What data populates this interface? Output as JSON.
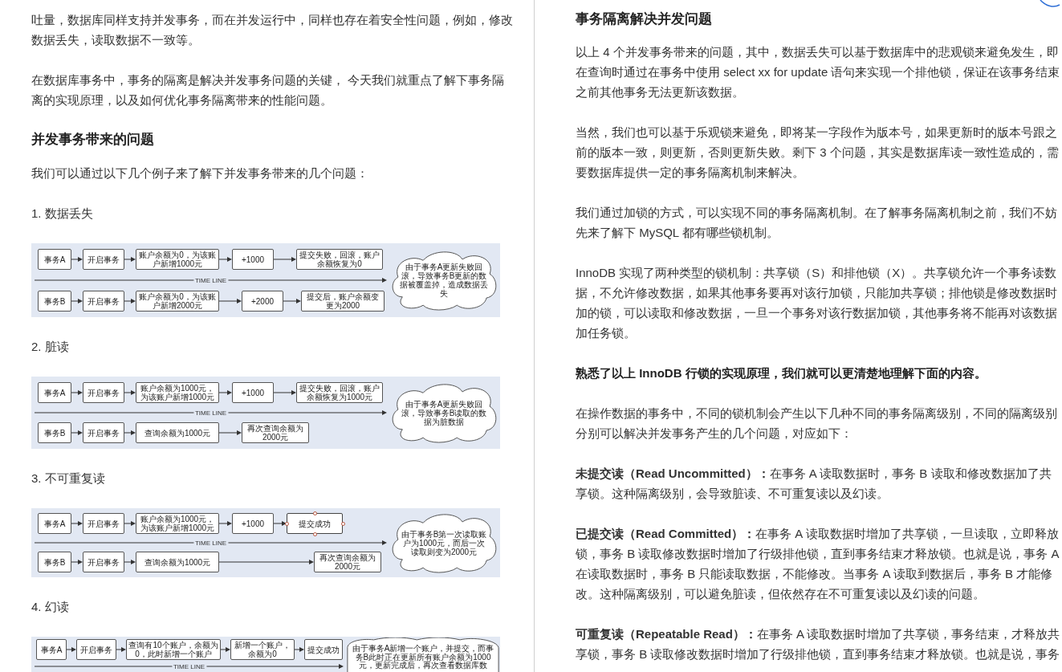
{
  "left_page": {
    "blocks": [
      {
        "kind": "paragraph",
        "text": "吐量，数据库同样支持并发事务，而在并发运行中，同样也存在着安全性问题，例如，修改数据丢失，读取数据不一致等。"
      },
      {
        "kind": "paragraph",
        "text": "在数据库事务中，事务的隔离是解决并发事务问题的关键， 今天我们就重点了解下事务隔离的实现原理，以及如何优化事务隔离带来的性能问题。"
      },
      {
        "kind": "heading",
        "text": "并发事务带来的问题"
      },
      {
        "kind": "paragraph",
        "text": "我们可以通过以下几个例子来了解下并发事务带来的几个问题："
      },
      {
        "kind": "item_title",
        "text": "1. 数据丢失"
      },
      {
        "kind": "diagram",
        "row_a": [
          {
            "text": "事务A",
            "selected": false
          },
          {
            "text": "开启事务",
            "selected": false
          },
          {
            "text": "账户余额为0，为该账户新增1000元",
            "selected": false
          },
          {
            "text": "+1000",
            "selected": false
          },
          {
            "text": "提交失败，回滚，账户余额恢复为0",
            "selected": false
          }
        ],
        "row_b": [
          {
            "text": "事务B",
            "selected": false
          },
          {
            "text": "开启事务",
            "selected": false
          },
          {
            "text": "账户余额为0，为该账户新增2000元",
            "selected": false
          },
          {
            "text": "+2000",
            "selected": false
          },
          {
            "text": "提交后，账户余额变更为2000",
            "selected": false
          }
        ],
        "timeline": "TIME LINE",
        "note": "由于事务A更新失败回滚，导致事务B更新的数据被覆盖掉，造成数据丢失"
      },
      {
        "kind": "item_title",
        "text": "2. 脏读"
      },
      {
        "kind": "diagram",
        "row_a": [
          {
            "text": "事务A",
            "selected": false
          },
          {
            "text": "开启事务",
            "selected": false
          },
          {
            "text": "账户余额为1000元，为该账户新增1000元",
            "selected": false
          },
          {
            "text": "+1000",
            "selected": false
          },
          {
            "text": "提交失败，回滚，账户余额恢复为1000元",
            "selected": false
          }
        ],
        "row_b": [
          {
            "text": "事务B",
            "selected": false
          },
          {
            "text": "开启事务",
            "selected": false
          },
          {
            "text": "查询余额为1000元",
            "selected": false
          },
          {
            "text": "再次查询余额为2000元",
            "selected": false
          }
        ],
        "timeline": "TIME LINE",
        "note": "由于事务A更新失败回滚，导致事务B读取的数据为脏数据"
      },
      {
        "kind": "item_title",
        "text": "3. 不可重复读"
      },
      {
        "kind": "diagram",
        "row_a": [
          {
            "text": "事务A",
            "selected": false
          },
          {
            "text": "开启事务",
            "selected": false
          },
          {
            "text": "账户余额为1000元，为该账户新增1000元",
            "selected": false
          },
          {
            "text": "+1000",
            "selected": false
          },
          {
            "text": "提交成功",
            "selected": true
          }
        ],
        "row_b": [
          {
            "text": "事务B",
            "selected": false
          },
          {
            "text": "开启事务",
            "selected": false
          },
          {
            "text": "查询余额为1000元",
            "selected": false
          },
          {
            "text": "再次查询余额为2000元",
            "selected": false
          }
        ],
        "timeline": "TIME LINE",
        "note": "由于事务B第一次读取账户为1000元，而后一次读取则变为2000元"
      },
      {
        "kind": "item_title",
        "text": "4. 幻读"
      },
      {
        "kind": "diagram",
        "row_a": [
          {
            "text": "事务A",
            "selected": false
          },
          {
            "text": "开启事务",
            "selected": false
          },
          {
            "text": "查询有10个账户，余额为0，此时新增一个账户",
            "selected": false
          },
          {
            "text": "新增一个账户，余额为0",
            "selected": false
          },
          {
            "text": "提交成功",
            "selected": false
          }
        ],
        "timeline": "TIME LINE",
        "note": "由于事务A新增一个账户，并提交，而事务B此时正在更新所有账户余额为1000元，更新完成后，再次查看数据库数"
      }
    ]
  },
  "right_page": {
    "heading": "事务隔离解决并发问题",
    "paragraphs": [
      {
        "kind": "plain",
        "text": "以上 4 个并发事务带来的问题，其中，数据丢失可以基于数据库中的悲观锁来避免发生，即在查询时通过在事务中使用 select xx for update 语句来实现一个排他锁，保证在该事务结束之前其他事务无法更新该数据。"
      },
      {
        "kind": "plain",
        "text": "当然，我们也可以基于乐观锁来避免，即将某一字段作为版本号，如果更新时的版本号跟之前的版本一致，则更新，否则更新失败。剩下 3 个问题，其实是数据库读一致性造成的，需要数据库提供一定的事务隔离机制来解决。"
      },
      {
        "kind": "plain",
        "text": "我们通过加锁的方式，可以实现不同的事务隔离机制。在了解事务隔离机制之前，我们不妨先来了解下 MySQL 都有哪些锁机制。"
      },
      {
        "kind": "plain",
        "text": "InnoDB 实现了两种类型的锁机制：共享锁（S）和排他锁（X）。共享锁允许一个事务读数据，不允许修改数据，如果其他事务要再对该行加锁，只能加共享锁；排他锁是修改数据时加的锁，可以读取和修改数据，一旦一个事务对该行数据加锁，其他事务将不能再对该数据加任务锁。"
      },
      {
        "kind": "strong",
        "text": "熟悉了以上 InnoDB 行锁的实现原理，我们就可以更清楚地理解下面的内容。"
      },
      {
        "kind": "plain",
        "text": "在操作数据的事务中，不同的锁机制会产生以下几种不同的事务隔离级别，不同的隔离级别分别可以解决并发事务产生的几个问题，对应如下："
      },
      {
        "kind": "plain",
        "text": "**未提交读（Read Uncommitted）：**在事务 A 读取数据时，事务 B 读取和修改数据加了共享锁。这种隔离级别，会导致脏读、不可重复读以及幻读。"
      },
      {
        "kind": "plain",
        "text": "**已提交读（Read Committed）：**在事务 A 读取数据时增加了共享锁，一旦读取，立即释放锁，事务 B 读取修改数据时增加了行级排他锁，直到事务结束才释放锁。也就是说，事务 A 在读取数据时，事务 B 只能读取数据，不能修改。当事务 A 读取到数据后，事务 B 才能修改。这种隔离级别，可以避免脏读，但依然存在不可重复读以及幻读的问题。"
      },
      {
        "kind": "plain",
        "text": "**可重复读（Repeatable Read）：**在事务 A 读取数据时增加了共享锁，事务结束，才释放共享锁，事务 B 读取修改数据时增加了行级排他锁，直到事务结束才释放锁。也就是说，事务"
      }
    ]
  }
}
